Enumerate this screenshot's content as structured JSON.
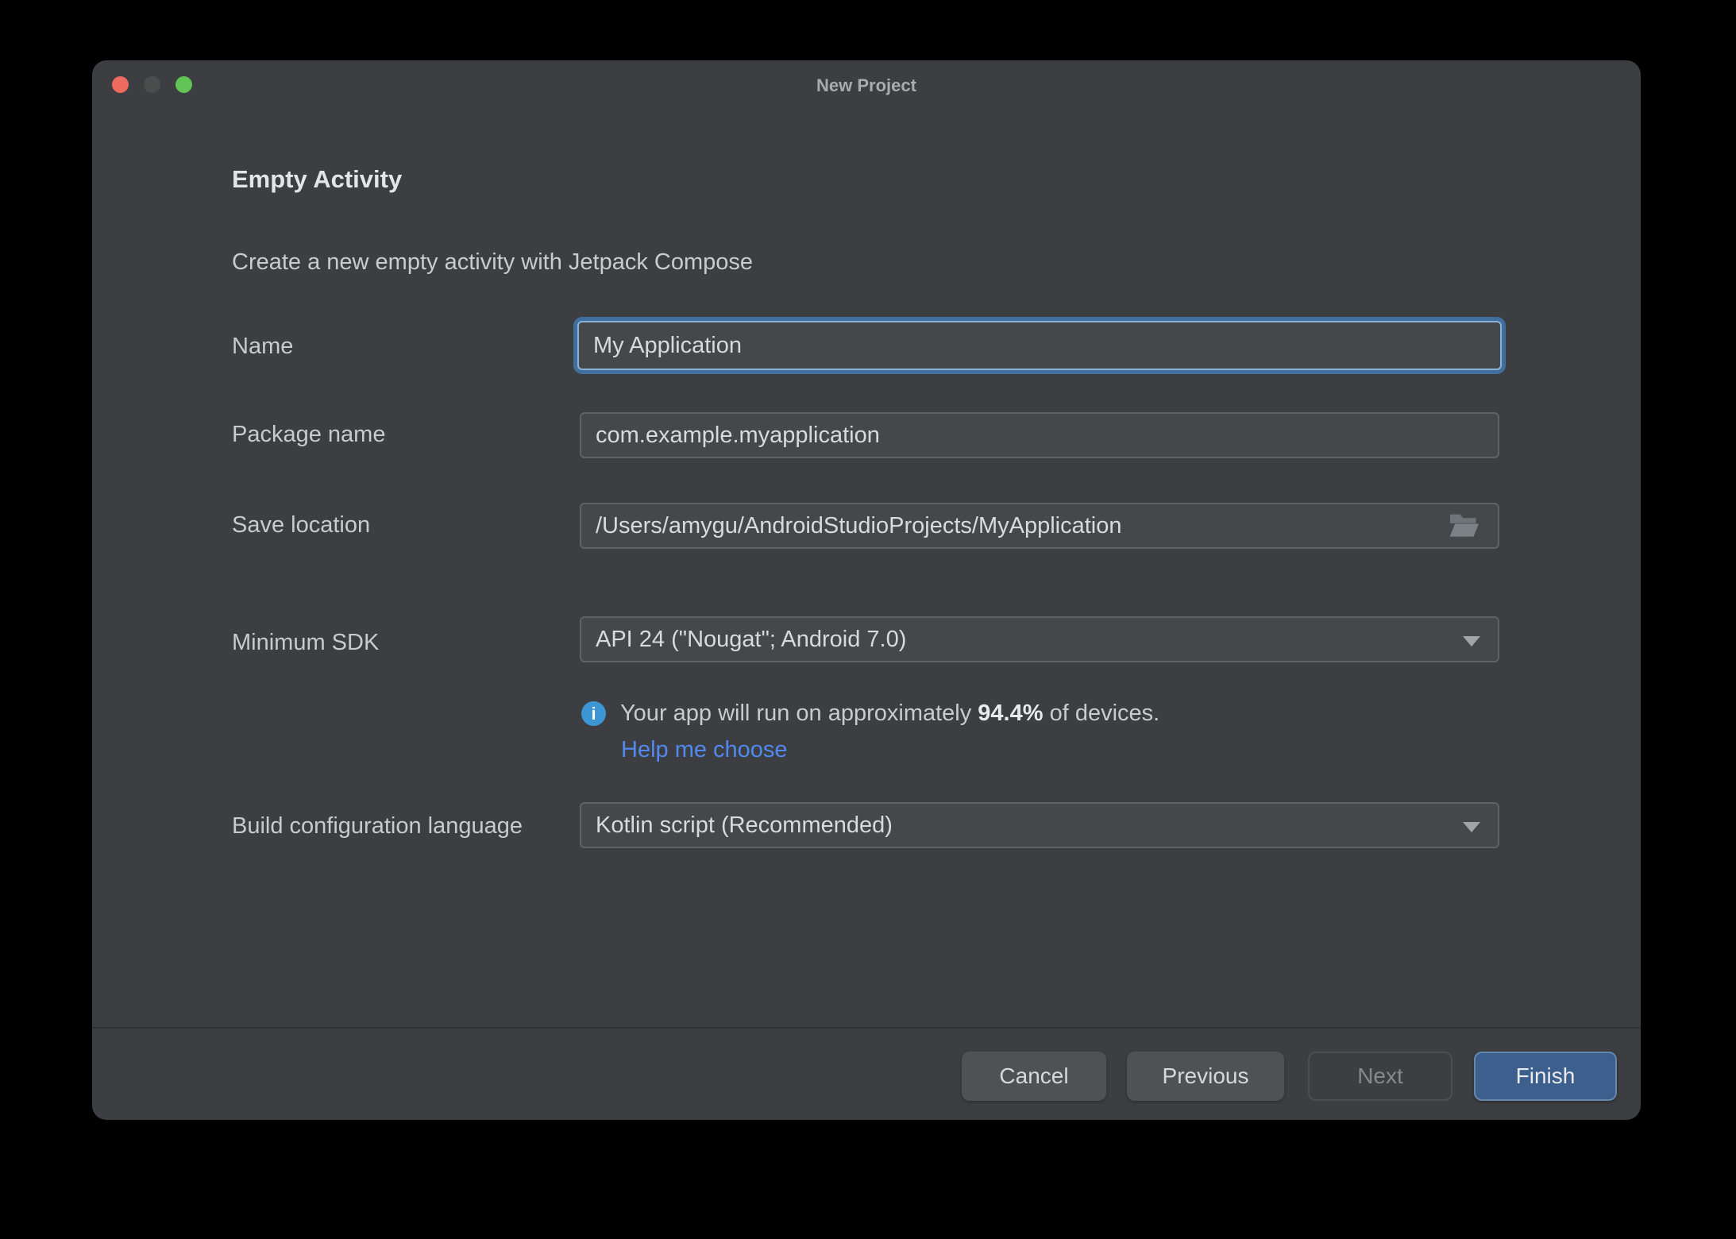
{
  "window": {
    "title": "New Project",
    "traffic_lights": {
      "close_color": "#ec6a5e",
      "minimize_color": "#4b4c4c",
      "zoom_color": "#61c455"
    }
  },
  "header": {
    "title": "Empty Activity",
    "subtitle": "Create a new empty activity with Jetpack Compose"
  },
  "form": {
    "name": {
      "label": "Name",
      "value": "My Application",
      "focused": true
    },
    "package": {
      "label": "Package name",
      "value": "com.example.myapplication"
    },
    "save_location": {
      "label": "Save location",
      "value": "/Users/amygu/AndroidStudioProjects/MyApplication",
      "icon": "folder-open-icon"
    },
    "min_sdk": {
      "label": "Minimum SDK",
      "value": "API 24 (\"Nougat\"; Android 7.0)",
      "icon": "chevron-down-icon"
    },
    "sdk_info": {
      "icon": "info-icon",
      "prefix": "Your app will run on approximately ",
      "percent": "94.4%",
      "suffix": " of devices.",
      "link": "Help me choose",
      "link_color": "#5289ef",
      "icon_color": "#3d95d3"
    },
    "build_config": {
      "label": "Build configuration language",
      "value": "Kotlin script (Recommended)",
      "icon": "chevron-down-icon"
    }
  },
  "footer": {
    "buttons": [
      {
        "label": "Cancel",
        "state": "enabled",
        "style": "default"
      },
      {
        "label": "Previous",
        "state": "enabled",
        "style": "default"
      },
      {
        "label": "Next",
        "state": "disabled",
        "style": "outline"
      },
      {
        "label": "Finish",
        "state": "enabled",
        "style": "primary",
        "accent_color": "#3c5f8d"
      }
    ]
  },
  "colors": {
    "window_background": "#3c3e41",
    "field_background": "#45484b",
    "field_border": "#5f6366",
    "focus_ring": "#406f9f",
    "text_primary": "#d8dadc",
    "text_secondary": "#c8cacc"
  }
}
